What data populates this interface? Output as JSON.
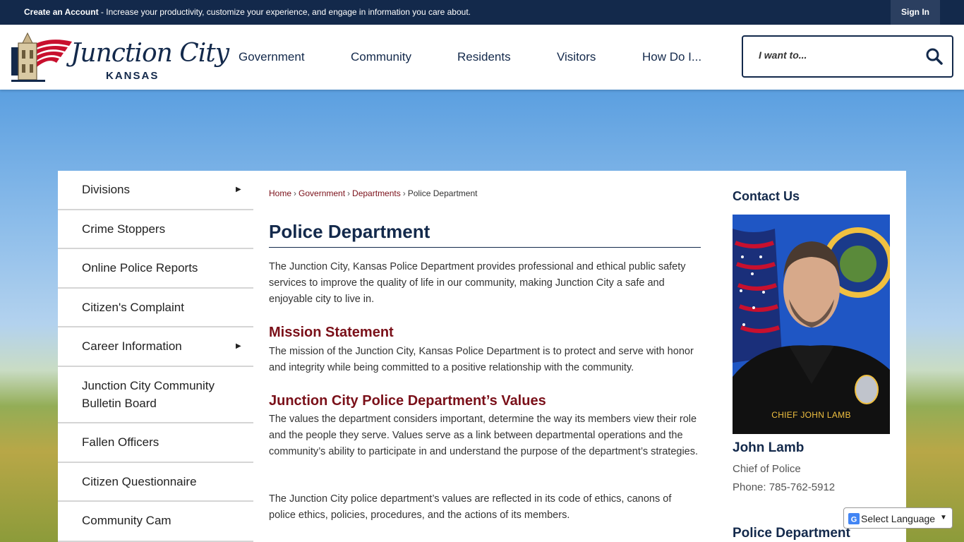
{
  "topbar": {
    "create_account": "Create an Account",
    "message": " - Increase your productivity, customize your experience, and engage in information you care about.",
    "sign_in": "Sign In"
  },
  "header": {
    "logo_script": "Junction City",
    "logo_state": "KANSAS",
    "nav": [
      "Government",
      "Community",
      "Residents",
      "Visitors",
      "How Do I..."
    ],
    "search_placeholder": "I want to..."
  },
  "sidebar": {
    "items": [
      {
        "label": "Divisions",
        "has_submenu": true
      },
      {
        "label": "Crime Stoppers",
        "has_submenu": false
      },
      {
        "label": "Online Police Reports",
        "has_submenu": false
      },
      {
        "label": "Citizen's Complaint",
        "has_submenu": false
      },
      {
        "label": "Career Information",
        "has_submenu": true
      },
      {
        "label": "Junction City Community",
        "label2": "Bulletin Board",
        "has_submenu": false
      },
      {
        "label": "Fallen Officers",
        "has_submenu": false
      },
      {
        "label": "Citizen Questionnaire",
        "has_submenu": false
      },
      {
        "label": "Community Cam",
        "has_submenu": false
      }
    ]
  },
  "breadcrumb": {
    "home": "Home",
    "government": "Government",
    "departments": "Departments",
    "current": "Police Department",
    "separator": "›"
  },
  "main": {
    "title": "Police Department",
    "intro": "The Junction City, Kansas Police Department provides professional and ethical public safety services to improve the quality of life in our community, making Junction City a safe and enjoyable city to live in.",
    "mission_heading": "Mission Statement",
    "mission_text": "The mission of the Junction City, Kansas Police Department is to protect and serve with honor and integrity while being committed to a positive relationship with the community.",
    "values_heading": "Junction City Police Department’s Values",
    "values_text": "The values the department considers important, determine the way its members view their role and the people they serve. Values serve as a link between departmental operations and the community’s ability to participate in and understand the purpose of the department’s strategies.",
    "values_text2": "The Junction City police department’s values are reflected in its code of ethics, canons of police ethics, policies, procedures, and the actions of its members."
  },
  "contact": {
    "heading": "Contact Us",
    "photo_caption": "CHIEF JOHN LAMB",
    "name": "John Lamb",
    "role": "Chief of Police",
    "phone": "Phone: 785-762-5912",
    "dept_heading": "Police Department"
  },
  "translate": {
    "label": "Select Language"
  },
  "colors": {
    "navy": "#13294b",
    "maroon": "#7a1019"
  },
  "icons": {
    "search": "search-icon",
    "submenu": "triangle-right-icon",
    "translate": "google-g-icon"
  }
}
